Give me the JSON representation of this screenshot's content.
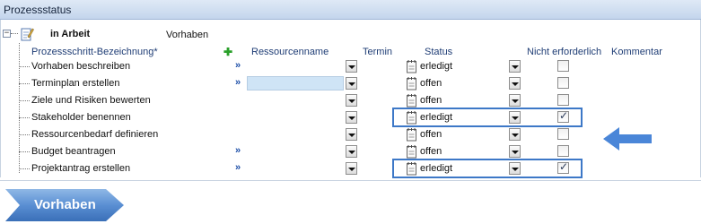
{
  "window": {
    "title": "Prozessstatus"
  },
  "phase": {
    "status": "in Arbeit",
    "name": "Vorhaben"
  },
  "columns": {
    "step": "Prozessschritt-Bezeichnung*",
    "resource": "Ressourcenname",
    "date": "Termin",
    "status": "Status",
    "not_required": "Nicht erforderlich",
    "comment": "Kommentar"
  },
  "more_marker": "»",
  "rows": [
    {
      "name": "Vorhaben beschreiben",
      "status": "erledigt",
      "not_required": false,
      "has_link": true,
      "highlight": false
    },
    {
      "name": "Terminplan  erstellen",
      "status": "offen",
      "not_required": false,
      "has_link": true,
      "highlight": false
    },
    {
      "name": "Ziele und Risiken bewerten",
      "status": "offen",
      "not_required": false,
      "has_link": false,
      "highlight": false
    },
    {
      "name": "Stakeholder benennen",
      "status": "erledigt",
      "not_required": true,
      "has_link": false,
      "highlight": true
    },
    {
      "name": "Ressourcenbedarf definieren",
      "status": "offen",
      "not_required": false,
      "has_link": false,
      "highlight": false
    },
    {
      "name": "Budget beantragen",
      "status": "offen",
      "not_required": false,
      "has_link": true,
      "highlight": false
    },
    {
      "name": "Projektantrag erstellen",
      "status": "erledigt",
      "not_required": true,
      "has_link": true,
      "highlight": true
    }
  ],
  "bottom_button": {
    "label": "Vorhaben"
  },
  "icons": {
    "phase": "notepad-pencil-icon",
    "status": "notepad-icon",
    "add": "plus-icon",
    "pointer": "arrow-left-icon"
  },
  "colors": {
    "accent": "#3d78c7",
    "link": "#1d4fa8",
    "header_text": "#1f3d75",
    "add": "#2aa02a"
  }
}
